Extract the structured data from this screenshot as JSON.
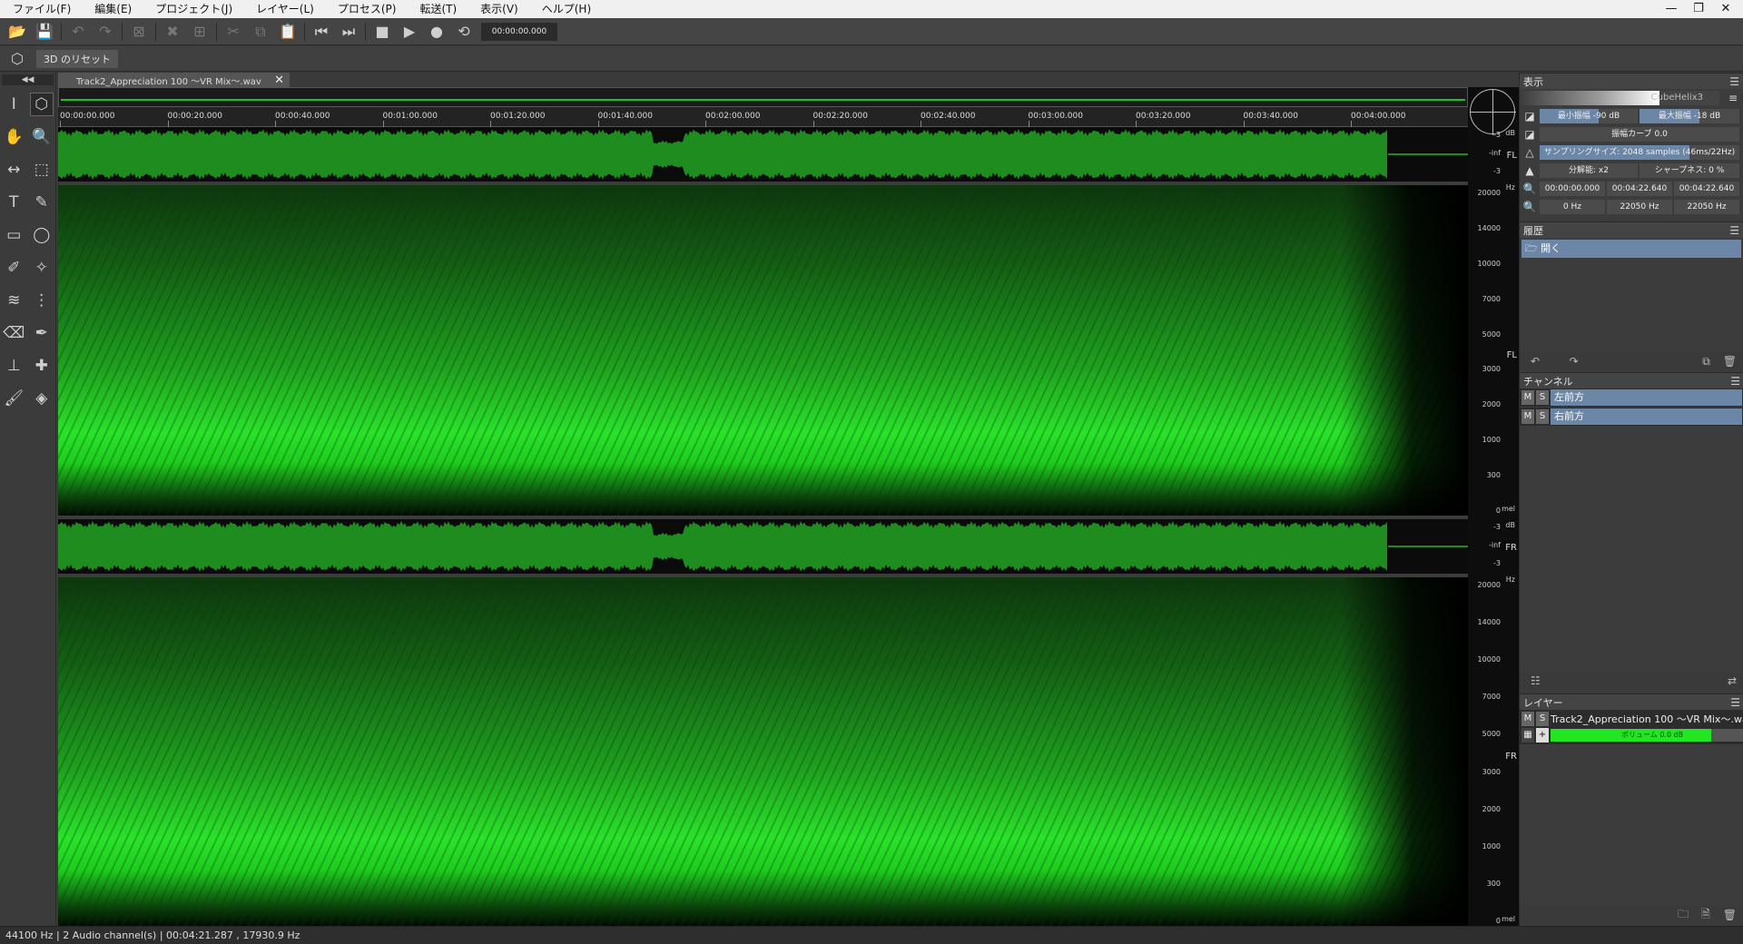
{
  "menu": [
    "ファイル(F)",
    "編集(E)",
    "プロジェクト(J)",
    "レイヤー(L)",
    "プロセス(P)",
    "転送(T)",
    "表示(V)",
    "ヘルプ(H)"
  ],
  "toolbar": {
    "time": "00:00:00.000"
  },
  "toolbar2": {
    "reset3d": "3D のリセット"
  },
  "doc_tab": {
    "title": "Track2_Appreciation 100 〜VR Mix〜.wav"
  },
  "ruler": [
    "00:00:00.000",
    "00:00:20.000",
    "00:00:40.000",
    "00:01:00.000",
    "00:01:20.000",
    "00:01:40.000",
    "00:02:00.000",
    "00:02:20.000",
    "00:02:40.000",
    "00:03:00.000",
    "00:03:20.000",
    "00:03:40.000",
    "00:04:00.000"
  ],
  "axis": {
    "db_unit": "dB",
    "hz_unit": "Hz",
    "mel_unit": "mel",
    "db_ticks": [
      "-3",
      "-inf",
      "-3"
    ],
    "hz_ticks": [
      "20000",
      "14000",
      "10000",
      "7000",
      "5000",
      "3000",
      "2000",
      "1000",
      "300",
      "0"
    ],
    "ch_fl": "FL",
    "ch_fr": "FR"
  },
  "display_panel": {
    "title": "表示",
    "colormap": "CubeHelix3",
    "min_amp": "最小振幅 -90 dB",
    "max_amp": "最大振幅 -18 dB",
    "amp_curve": "振幅カーブ 0.0",
    "sampling": "サンプリングサイズ: 2048 samples (46ms/22Hz)",
    "resolution": "分解能: x2",
    "sharpness": "シャープネス: 0 %",
    "time_start": "00:00:00.000",
    "time_end": "00:04:22.640",
    "time_len": "00:04:22.640",
    "freq_min": "0 Hz",
    "freq_max": "22050 Hz",
    "freq_range": "22050 Hz"
  },
  "history_panel": {
    "title": "履歴",
    "items": [
      "開く"
    ]
  },
  "channel_panel": {
    "title": "チャンネル",
    "channels": [
      "左前方",
      "右前方"
    ]
  },
  "layer_panel": {
    "title": "レイヤー",
    "layer_name": "Track2_Appreciation 100 〜VR Mix〜.wav",
    "volume": "ボリューム 0.0 dB"
  },
  "status": "44100 Hz | 2 Audio channel(s) | 00:04:21.287 , 17930.9 Hz",
  "colors": {
    "wave": "#1e8c1e",
    "spectrum": "#2be22b",
    "selection": "#6b86a6",
    "layer": "#22e622"
  }
}
